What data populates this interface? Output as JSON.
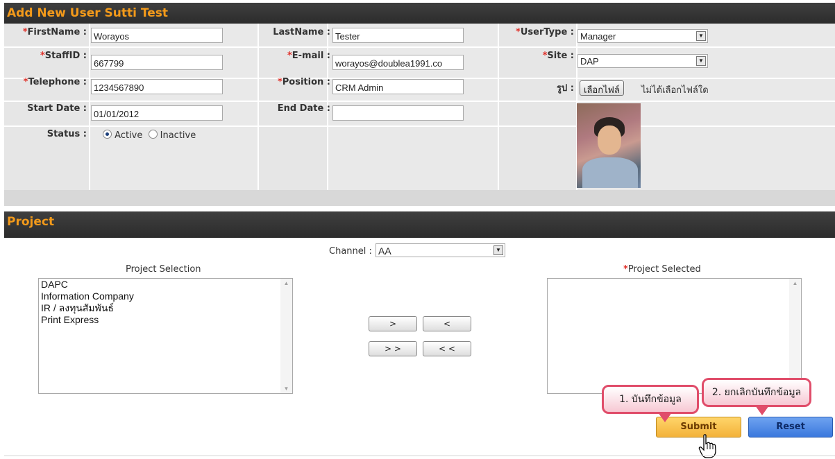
{
  "header": {
    "title": "Add New User Sutti Test"
  },
  "form": {
    "firstname": {
      "label": "FirstName :",
      "value": "Worayos"
    },
    "lastname": {
      "label": "LastName :",
      "value": "Tester"
    },
    "usertype": {
      "label": "UserType :",
      "value": "Manager"
    },
    "staffid": {
      "label": "StaffID :",
      "value": "667799"
    },
    "email": {
      "label": "E-mail :",
      "value": "worayos@doublea1991.co"
    },
    "site": {
      "label": "Site :",
      "value": "DAP"
    },
    "telephone": {
      "label": "Telephone :",
      "value": "1234567890"
    },
    "position": {
      "label": "Position :",
      "value": "CRM Admin"
    },
    "photo": {
      "label": "รูป :",
      "button": "เลือกไฟล์",
      "no_file": "ไม่ได้เลือกไฟล์ใด"
    },
    "start_date": {
      "label": "Start Date :",
      "value": "01/01/2012"
    },
    "end_date": {
      "label": "End Date :",
      "value": ""
    },
    "status": {
      "label": "Status :",
      "active": "Active",
      "inactive": "Inactive",
      "selected": "Active"
    },
    "required_mark": "*"
  },
  "project": {
    "title": "Project",
    "channel_label": "Channel :",
    "channel_value": "AA",
    "selection_title": "Project Selection",
    "selected_title": "Project Selected",
    "selection_items": [
      "DAPC",
      "Information Company",
      "IR / ลงทุนสัมพันธ์",
      "Print Express"
    ],
    "selected_items": [],
    "move_right": ">",
    "move_left": "<",
    "move_all_right": "> >",
    "move_all_left": "< <"
  },
  "actions": {
    "submit": "Submit",
    "reset": "Reset",
    "callout_submit": "1. บันทึกข้อมูล",
    "callout_reset": "2. ยกเลิกบันทึกข้อมูล"
  },
  "colors": {
    "header_text": "#f39a1a",
    "required": "#e0312a",
    "submit_bg": "#f3b23a",
    "reset_bg": "#3a78dd",
    "callout_border": "#e04d6a"
  },
  "icons": {
    "dropdown": "chevron-down-icon",
    "cursor": "hand-pointer-icon"
  }
}
